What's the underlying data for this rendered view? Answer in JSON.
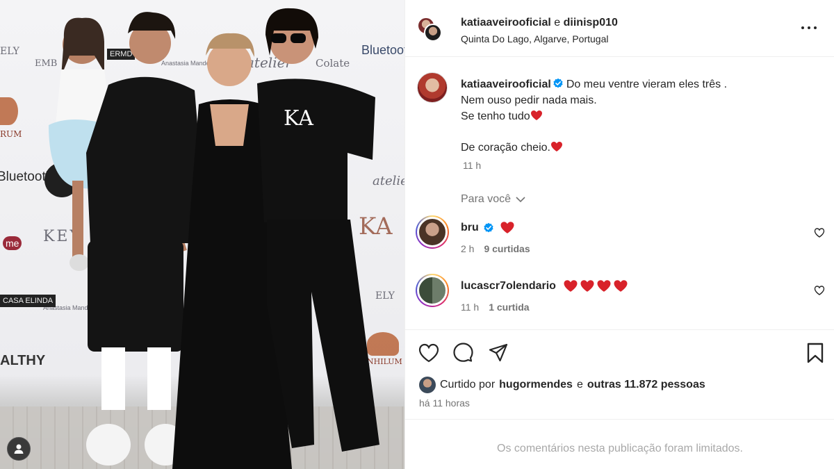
{
  "post": {
    "header": {
      "author_primary": "katiaaveirooficial",
      "joiner": " e ",
      "author_secondary": "diinisp010",
      "location": "Quinta Do Lago, Algarve, Portugal"
    },
    "caption": {
      "username": "katiaaveirooficial",
      "line1": "Do meu ventre vieram eles três .",
      "line2": "Nem ouso pedir nada mais.",
      "line3": "Se tenho tudo",
      "line4": "De coração cheio.",
      "time": "11 h"
    },
    "filter_label": "Para você",
    "comments": [
      {
        "username": "bru",
        "verified": true,
        "time": "2 h",
        "likes": "9 curtidas",
        "hearts": 1
      },
      {
        "username": "lucascr7olendario",
        "verified": false,
        "time": "11 h",
        "likes": "1 curtida",
        "hearts": 4
      }
    ],
    "liked_by": {
      "prefix": "Curtido por",
      "user": "hugormendes",
      "joiner": "e",
      "others": "outras 11.872 pessoas"
    },
    "posted_ago": "há 11 horas",
    "comments_limited": "Os comentários nesta publicação foram limitados."
  },
  "photo_backdrop_logos": [
    "Bluetooth",
    "Bluetooth",
    "atelier",
    "atelier",
    "KA",
    "KEY",
    "Anastasia Mandes",
    "Anastasia Mandes",
    "ELY",
    "ELY",
    "ALTHY",
    "EMB",
    "Colate",
    "ERMD",
    "CASA ELINDA",
    "me",
    "RUM",
    "NHILUM"
  ],
  "colors": {
    "verified_blue": "#0095f6",
    "heart_red": "#ed4956",
    "muted": "#737373"
  }
}
